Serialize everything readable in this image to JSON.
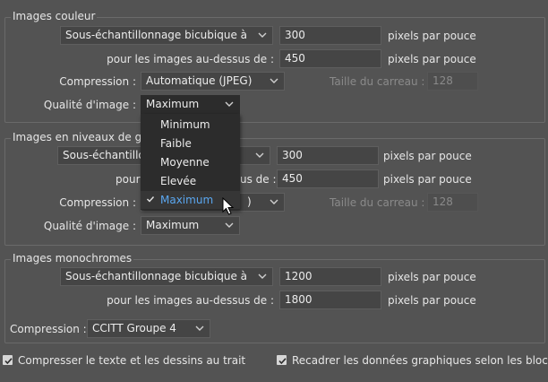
{
  "color_images": {
    "legend": "Images couleur",
    "method": "Sous-échantillonnage bicubique à",
    "resolution": "300",
    "resolution_unit": "pixels par pouce",
    "above_label": "pour les images au-dessus de :",
    "above_value": "450",
    "above_unit": "pixels par pouce",
    "compression_label": "Compression :",
    "compression_value": "Automatique (JPEG)",
    "tile_label": "Taille du carreau :",
    "tile_value": "128",
    "quality_label": "Qualité d'image :",
    "quality_value": "Maximum"
  },
  "quality_menu": {
    "options": [
      "Minimum",
      "Faible",
      "Moyenne",
      "Elevée",
      "Maximum"
    ],
    "selected": "Maximum"
  },
  "gray_images": {
    "legend": "Images en niveaux de gri",
    "method": "Sous-échantillo",
    "resolution": "300",
    "resolution_unit": "pixels par pouce",
    "above_label_left": "pour",
    "above_label_right": "us de :",
    "above_value": "450",
    "above_unit": "pixels par pouce",
    "compression_label": "Compression :",
    "compression_tail": ")",
    "tile_label": "Taille du carreau :",
    "tile_value": "128",
    "quality_label": "Qualité d'image :",
    "quality_value": "Maximum"
  },
  "mono_images": {
    "legend": "Images monochromes",
    "method": "Sous-échantillonnage bicubique à",
    "resolution": "1200",
    "resolution_unit": "pixels par pouce",
    "above_label": "pour les images au-dessus de :",
    "above_value": "1800",
    "above_unit": "pixels par pouce",
    "compression_label": "Compression :",
    "compression_value": "CCITT Groupe 4"
  },
  "options": {
    "compress_text": "Compresser le texte et les dessins au trait",
    "compress_text_checked": true,
    "crop_data": "Recadrer les données graphiques selon les blocs",
    "crop_data_checked": true
  },
  "colors": {
    "accent": "#5aa7f0",
    "background": "#535353"
  }
}
